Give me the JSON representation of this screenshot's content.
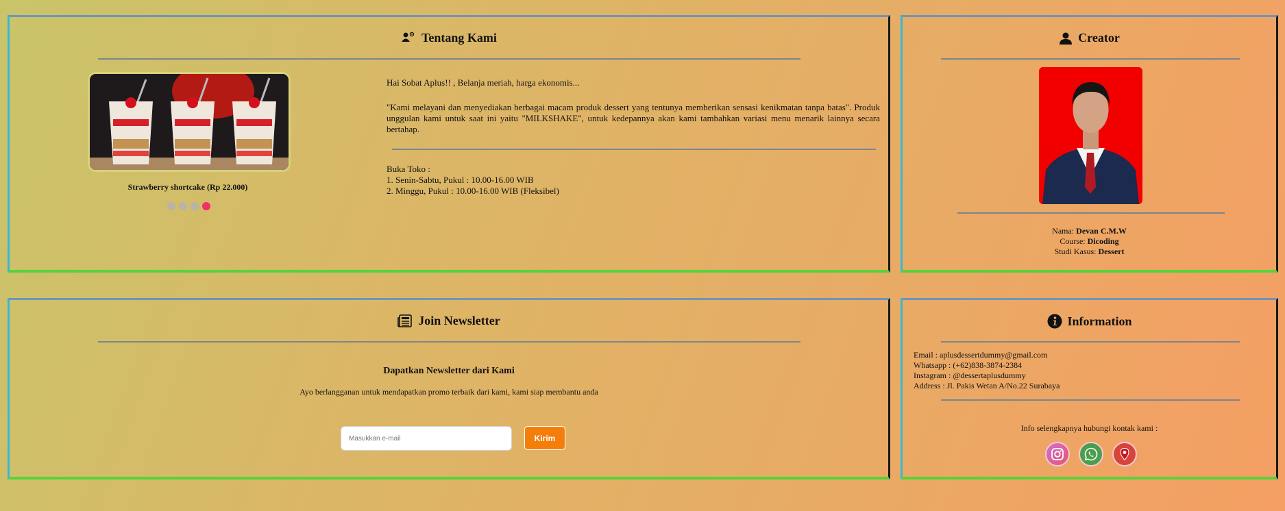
{
  "about": {
    "title": "Tentang Kami",
    "title_icon": "users-cog-icon",
    "slider_caption": "Strawberry shortcake (Rp 22.000)",
    "slider": {
      "total": 4,
      "active_index": 3
    },
    "greeting": "Hai Sobat Aplus!! , Belanja meriah, harga ekonomis...",
    "description": "\"Kami melayani dan menyediakan berbagai macam produk dessert yang tentunya memberikan sensasi kenikmatan tanpa batas\". Produk unggulan kami untuk saat ini yaitu \"MILKSHAKE\", untuk kedepannya akan kami tambahkan variasi menu menarik lainnya secara bertahap.",
    "hours_title": "Buka Toko :",
    "hours_1": "1. Senin-Sabtu, Pukul : 10.00-16.00 WIB",
    "hours_2": "2. Minggu, Pukul : 10.00-16.00 WIB (Fleksibel)"
  },
  "creator": {
    "title": "Creator",
    "title_icon": "user-icon",
    "name_label": "Nama: ",
    "name": "Devan C.M.W",
    "course_label": "Course: ",
    "course": "Dicoding",
    "case_label": "Studi Kasus: ",
    "case": "Dessert"
  },
  "newsletter": {
    "title": "Join Newsletter",
    "title_icon": "newspaper-icon",
    "heading": "Dapatkan Newsletter dari Kami",
    "subtitle": "Ayo berlangganan untuk mendapatkan promo terbaik dari kami, kami siap membantu anda",
    "input_placeholder": "Masukkan e-mail",
    "button_label": "Kirim"
  },
  "info": {
    "title": "Information",
    "title_icon": "info-circle-icon",
    "email": "Email : aplusdessertdummy@gmail.com",
    "whatsapp": "Whatsapp : (+62)838-3874-2384",
    "instagram": "Instagram : @dessertaplusdummy",
    "address": "Address : Jl. Pakis Wetan A/No.22 Surabaya",
    "more": "Info selengkapnya hubungi kontak kami :",
    "socials": [
      "instagram-icon",
      "whatsapp-icon",
      "location-icon"
    ]
  },
  "colors": {
    "accent_orange": "#f57e0a",
    "slider_active": "#f0306a",
    "border_bottom": "#55d43a",
    "border_left": "#37b8d5"
  }
}
